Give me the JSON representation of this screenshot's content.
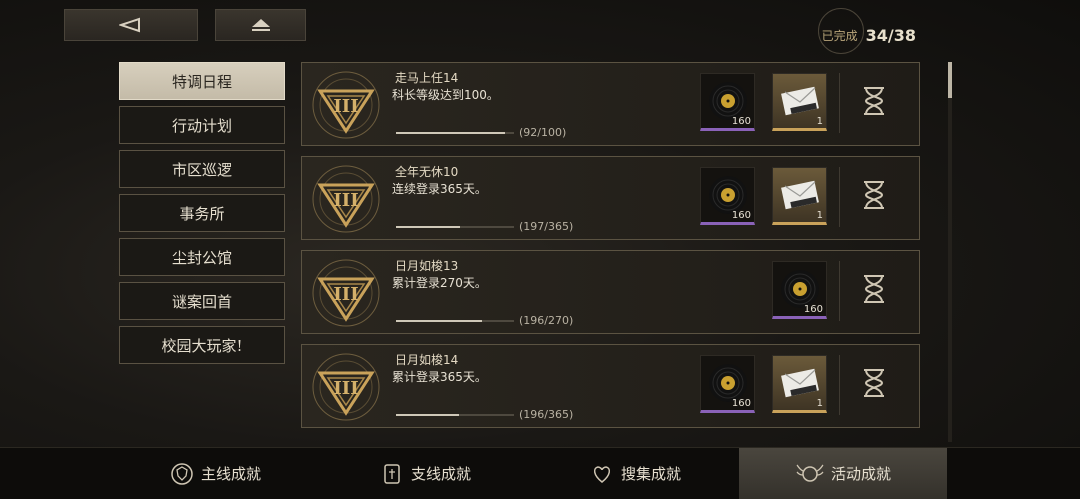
{
  "header": {
    "back_icon": "back-arrow-icon",
    "home_icon": "home-eject-icon",
    "completion_label": "已完成",
    "completion_value": "34/38"
  },
  "tabs": [
    {
      "label": "特调日程",
      "active": true
    },
    {
      "label": "行动计划",
      "active": false
    },
    {
      "label": "市区巡逻",
      "active": false
    },
    {
      "label": "事务所",
      "active": false
    },
    {
      "label": "尘封公馆",
      "active": false
    },
    {
      "label": "谜案回首",
      "active": false
    },
    {
      "label": "校园大玩家!",
      "active": false
    }
  ],
  "achievements": [
    {
      "title": "走马上任14",
      "desc": "科长等级达到100。",
      "progress_text": "(92/100)",
      "progress": 0.92,
      "rewards": [
        {
          "type": "record",
          "count": "160"
        },
        {
          "type": "letter",
          "count": "1"
        }
      ],
      "status_icon": "hourglass-icon"
    },
    {
      "title": "全年无休10",
      "desc": "连续登录365天。",
      "progress_text": "(197/365)",
      "progress": 0.54,
      "rewards": [
        {
          "type": "record",
          "count": "160"
        },
        {
          "type": "letter",
          "count": "1"
        }
      ],
      "status_icon": "hourglass-icon"
    },
    {
      "title": "日月如梭13",
      "desc": "累计登录270天。",
      "progress_text": "(196/270)",
      "progress": 0.726,
      "rewards": [
        {
          "type": "record",
          "count": "160"
        }
      ],
      "status_icon": "hourglass-icon"
    },
    {
      "title": "日月如梭14",
      "desc": "累计登录365天。",
      "progress_text": "(196/365)",
      "progress": 0.537,
      "rewards": [
        {
          "type": "record",
          "count": "160"
        },
        {
          "type": "letter",
          "count": "1"
        }
      ],
      "status_icon": "hourglass-icon"
    }
  ],
  "bottom_nav": [
    {
      "label": "主线成就",
      "icon": "shield-badge-icon",
      "active": false
    },
    {
      "label": "支线成就",
      "icon": "scroll-badge-icon",
      "active": false
    },
    {
      "label": "搜集成就",
      "icon": "heart-badge-icon",
      "active": false
    },
    {
      "label": "活动成就",
      "icon": "winged-badge-icon",
      "active": true
    }
  ],
  "colors": {
    "accent_gold": "#c9a25a",
    "record_purple": "#8a62b8",
    "active_tab_bg": "#cfc7b4"
  }
}
